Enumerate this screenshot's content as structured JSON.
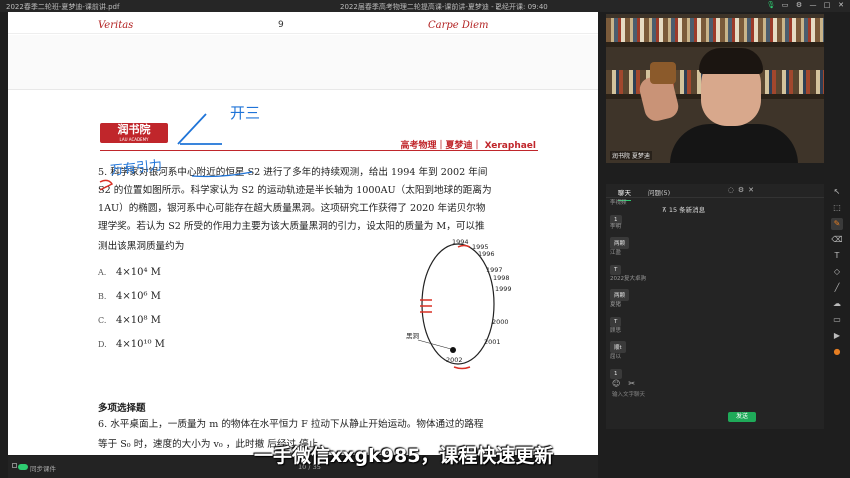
{
  "window": {
    "left_title": "2022春季二轮班-夏梦迪-课前讲.pdf",
    "center_title": "2022届春季高考物理二轮提高课-课前讲-夏梦迪 - 2",
    "timer": "已经开课: 09:40"
  },
  "document": {
    "header_left": "Veritas",
    "page_number": "9",
    "header_right": "Carpe Diem",
    "logo_text": "润书院",
    "logo_sub": "LAU ACADEMY",
    "brand": "高考物理｜夏梦迪｜ Xeraphael",
    "question_lines": [
      "5. 科学家对银河系中心附近的恒星 S2 进行了多年的持续观测，给出 1994 年到 2002 年间",
      "S2 的位置如图所示。科学家认为 S2 的运动轨迹是半长轴为 1000AU（太阳到地球的距离为",
      "1AU）的椭圆，银河系中心可能存在超大质量黑洞。这项研究工作获得了 2020 年诺贝尔物",
      "理学奖。若认为 S2 所受的作用力主要为该大质量黑洞的引力，设太阳的质量为 M，可以推",
      "测出该黑洞质量约为"
    ],
    "options": [
      {
        "letter": "A.",
        "text": "4×10⁴ M"
      },
      {
        "letter": "B.",
        "text": "4×10⁶ M"
      },
      {
        "letter": "C.",
        "text": "4×10⁸ M"
      },
      {
        "letter": "D.",
        "text": "4×10¹⁰ M"
      }
    ],
    "figure_labels": {
      "y1994": "1994",
      "y1995": "1995",
      "y1996": "1996",
      "y1997": "1997",
      "y1998": "1998",
      "y1999": "1999",
      "y2000": "2000",
      "y2001": "2001",
      "y2002": "2002",
      "black_hole": "黑洞"
    },
    "section_title": "多项选择题",
    "question6_lines": [
      "6. 水平桌面上，一质量为 m 的物体在水平恒力 F 拉动下从静止开始运动。物体通过的路程",
      "等于 S₀ 时，速度的大小为 v₀ ，此时撤    后经过    停止"
    ],
    "annotations": {
      "handwriting_1": "万有引力",
      "handwriting_2": "开三"
    }
  },
  "doc_bar": {
    "sync_label": "同步课件",
    "page_indicator": "10 / 35"
  },
  "subtitle": "一手微信xxgk985，课程快速更新",
  "video": {
    "label": "润书院 夏梦迪"
  },
  "chat": {
    "tab_chat": "聊天",
    "tab_questions": "问题(5)",
    "unread_notice": "⊼ 15 条新消息",
    "messages": [
      {
        "name": "李视频",
        "text": "1"
      },
      {
        "name": "李明",
        "text": "两颗"
      },
      {
        "name": "江盈",
        "text": "T"
      },
      {
        "name": "2022复大卓驹",
        "text": "两颗"
      },
      {
        "name": "夏猪",
        "text": "T"
      },
      {
        "name": "顾思",
        "text": "顺t"
      },
      {
        "name": "屈以",
        "text": "1"
      }
    ],
    "input_placeholder": "输入文字聊天",
    "send_label": "发送"
  },
  "toolbar": {
    "icons": [
      "pointer-icon",
      "select-icon",
      "pen-icon",
      "eraser-icon",
      "text-icon",
      "shape-icon",
      "line-icon",
      "cloud-icon",
      "screenshot-icon",
      "video-icon",
      "group-icon"
    ]
  }
}
